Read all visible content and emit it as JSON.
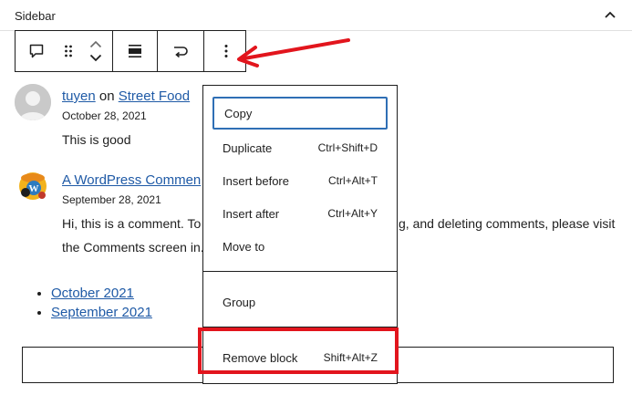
{
  "sidebar": {
    "title": "Sidebar",
    "collapse_icon": "chevron-up-icon"
  },
  "toolbar": {
    "buttons": [
      {
        "name": "comment-block-icon"
      },
      {
        "name": "drag-handle-icon"
      },
      {
        "name": "move-up-icon"
      },
      {
        "name": "move-down-icon"
      },
      {
        "name": "align-icon"
      },
      {
        "name": "transform-icon"
      },
      {
        "name": "more-options-icon"
      }
    ]
  },
  "comments": [
    {
      "author": "tuyen",
      "connector": "on",
      "post": "Street Food",
      "date": "October 28, 2021",
      "text": "This is good",
      "avatar": "default-avatar-icon"
    },
    {
      "author": "A WordPress Commen",
      "date": "September 28, 2021",
      "text_line1_left": "Hi, this is a comment. To",
      "text_line1_right": "g, and deleting comments, please visit",
      "text_line2": "the Comments screen in.",
      "avatar": "wordpress-avatar-icon"
    }
  ],
  "archives": [
    "October 2021",
    "September 2021"
  ],
  "menu": {
    "items": [
      {
        "label": "Copy",
        "shortcut": ""
      },
      {
        "label": "Duplicate",
        "shortcut": "Ctrl+Shift+D"
      },
      {
        "label": "Insert before",
        "shortcut": "Ctrl+Alt+T"
      },
      {
        "label": "Insert after",
        "shortcut": "Ctrl+Alt+Y"
      },
      {
        "label": "Move to",
        "shortcut": ""
      },
      {
        "label": "Group",
        "shortcut": ""
      },
      {
        "label": "Remove block",
        "shortcut": "Shift+Alt+Z"
      }
    ]
  },
  "annotation": {
    "color": "#e2151d",
    "highlighted_item": "Remove block"
  }
}
